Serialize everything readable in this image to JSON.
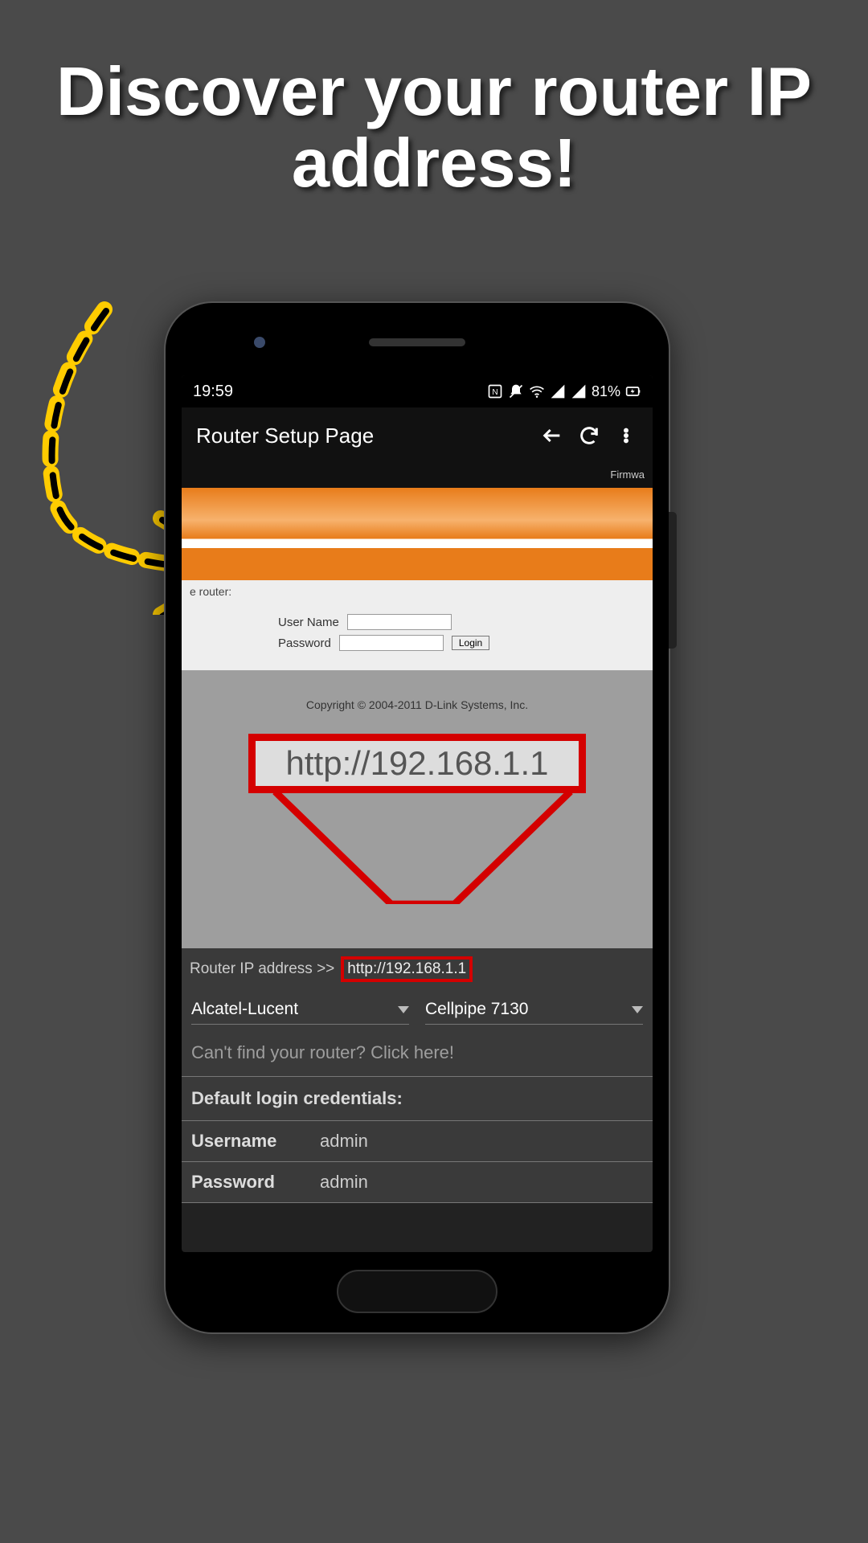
{
  "headline": "Discover your router IP address!",
  "status": {
    "time": "19:59",
    "battery": "81%"
  },
  "header": {
    "title": "Router Setup Page"
  },
  "webview": {
    "firmware_label": "Firmwa",
    "router_label": "e router:",
    "username_label": "User Name",
    "password_label": "Password",
    "login_label": "Login",
    "copyright": "Copyright © 2004-2011 D-Link Systems, Inc.",
    "zoom_url": "http://192.168.1.1"
  },
  "app": {
    "ip_label": "Router IP address >>",
    "ip_value": "http://192.168.1.1",
    "brand_dropdown": "Alcatel-Lucent",
    "model_dropdown": "Cellpipe 7130",
    "help_link": "Can't find your router? Click here!",
    "cred_heading": "Default login credentials:",
    "username_label": "Username",
    "username_value": "admin",
    "password_label": "Password",
    "password_value": "admin"
  }
}
